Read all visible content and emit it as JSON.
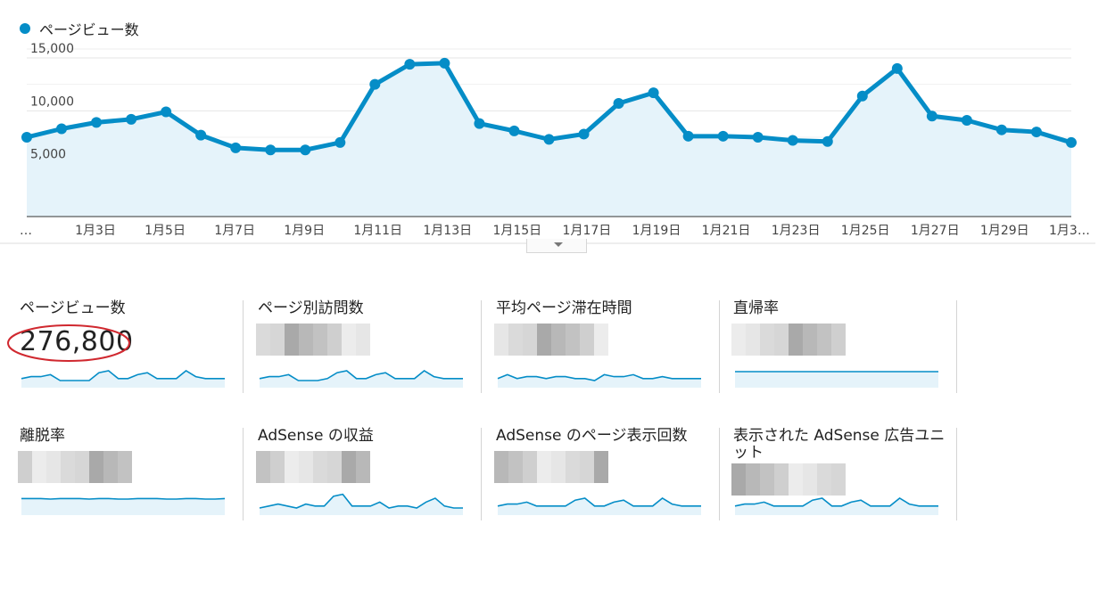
{
  "legend": {
    "label": "ページビュー数",
    "color": "#058dc7"
  },
  "chart_data": {
    "type": "area",
    "series": [
      {
        "name": "ページビュー数",
        "values": [
          7500,
          8300,
          8900,
          9200,
          9900,
          7700,
          6500,
          6300,
          6300,
          7000,
          12500,
          14400,
          14500,
          8800,
          8100,
          7300,
          7800,
          10700,
          11700,
          7600,
          7600,
          7500,
          7200,
          7100,
          11400,
          14000,
          9500,
          9100,
          8200,
          8000,
          7000
        ]
      }
    ],
    "x_tick_labels": [
      "…",
      "1月3日",
      "1月5日",
      "1月7日",
      "1月9日",
      "1月11日",
      "1月13日",
      "1月15日",
      "1月17日",
      "1月19日",
      "1月21日",
      "1月23日",
      "1月25日",
      "1月27日",
      "1月29日",
      "1月3…"
    ],
    "y_tick_labels": [
      "15,000",
      "10,000",
      "5,000"
    ],
    "y_ticks": [
      15000,
      10000,
      5000
    ],
    "ylim": [
      0,
      15000
    ],
    "grid": true,
    "line_color": "#058dc7",
    "fill_color": "#e5f3fa",
    "legend_placement": "top-left"
  },
  "cards": [
    {
      "title": "ページビュー数",
      "value": "276,800",
      "spark": [
        5,
        6,
        6,
        7,
        4,
        4,
        4,
        4,
        8,
        9,
        5,
        5,
        7,
        8,
        5,
        5,
        5,
        9,
        6,
        5,
        5,
        5
      ],
      "highlighted": true,
      "flat": false
    },
    {
      "title": "ページ別訪問数",
      "value": "",
      "spark": [
        5,
        6,
        6,
        7,
        4,
        4,
        4,
        5,
        8,
        9,
        5,
        5,
        7,
        8,
        5,
        5,
        5,
        9,
        6,
        5,
        5,
        5
      ],
      "highlighted": false,
      "flat": false
    },
    {
      "title": "平均ページ滞在時間",
      "value": "",
      "spark": [
        5,
        7,
        5,
        6,
        6,
        5,
        6,
        6,
        5,
        5,
        4,
        7,
        6,
        6,
        7,
        5,
        5,
        6,
        5,
        5,
        5,
        5
      ],
      "highlighted": false,
      "flat": false
    },
    {
      "title": "直帰率",
      "value": "",
      "spark": [
        5,
        5,
        5,
        5,
        5,
        5,
        5,
        5,
        5,
        5,
        5,
        5,
        5,
        5,
        5,
        5,
        5,
        5,
        5,
        5,
        5,
        5
      ],
      "highlighted": false,
      "flat": true
    },
    {
      "title": "離脱率",
      "value": "",
      "spark": [
        6,
        6,
        6,
        5,
        6,
        6,
        6,
        5,
        6,
        6,
        5,
        5,
        6,
        6,
        6,
        5,
        5,
        6,
        6,
        5,
        5,
        6
      ],
      "highlighted": false,
      "flat": true
    },
    {
      "title": "AdSense の収益",
      "value": "",
      "spark": [
        4,
        5,
        6,
        5,
        4,
        6,
        5,
        5,
        10,
        11,
        5,
        5,
        5,
        7,
        4,
        5,
        5,
        4,
        7,
        9,
        5,
        4,
        4
      ],
      "highlighted": false,
      "flat": false
    },
    {
      "title": "AdSense のページ表示回数",
      "value": "",
      "spark": [
        5,
        6,
        6,
        7,
        5,
        5,
        5,
        5,
        8,
        9,
        5,
        5,
        7,
        8,
        5,
        5,
        5,
        9,
        6,
        5,
        5,
        5
      ],
      "highlighted": false,
      "flat": false
    },
    {
      "title": "表示された AdSense 広告ユニット",
      "value": "",
      "spark": [
        5,
        6,
        6,
        7,
        5,
        5,
        5,
        5,
        8,
        9,
        5,
        5,
        7,
        8,
        5,
        5,
        5,
        9,
        6,
        5,
        5,
        5
      ],
      "highlighted": false,
      "flat": false
    }
  ],
  "highlight_color": "#d0282f"
}
